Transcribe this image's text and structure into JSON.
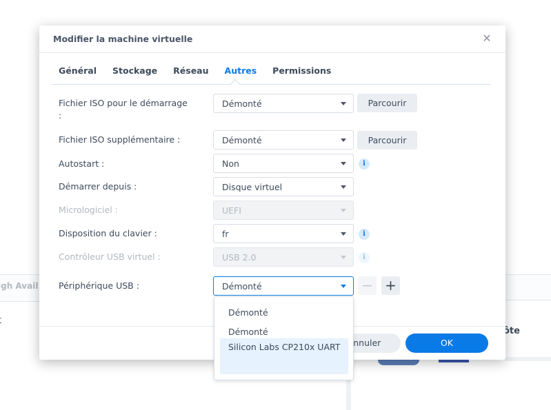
{
  "background": {
    "left_panel_title": "igh Avail",
    "left_text": "t",
    "right_text": "ôte"
  },
  "dialog": {
    "title": "Modifier la machine virtuelle",
    "close_icon": "close-icon",
    "tabs": [
      {
        "label": "Général",
        "active": false
      },
      {
        "label": "Stockage",
        "active": false
      },
      {
        "label": "Réseau",
        "active": false
      },
      {
        "label": "Autres",
        "active": true
      },
      {
        "label": "Permissions",
        "active": false
      }
    ],
    "accent_color": "#0a7ae6",
    "fields": {
      "boot_iso": {
        "label": "Fichier ISO pour le démarrage",
        "label_suffix": ":",
        "value": "Démonté",
        "button": "Parcourir"
      },
      "extra_iso": {
        "label": "Fichier ISO supplémentaire :",
        "value": "Démonté",
        "button": "Parcourir"
      },
      "autostart": {
        "label": "Autostart :",
        "value": "Non",
        "info_icon": "info-icon"
      },
      "boot_from": {
        "label": "Démarrer depuis :",
        "value": "Disque virtuel"
      },
      "firmware": {
        "label": "Micrologiciel :",
        "value": "UEFI",
        "disabled": true
      },
      "keyboard": {
        "label": "Disposition du clavier :",
        "value": "fr",
        "info_icon": "info-icon"
      },
      "usb_controller": {
        "label": "Contrôleur USB virtuel :",
        "value": "USB 2.0",
        "disabled": true,
        "info_icon": "info-icon"
      },
      "usb_device": {
        "label": "Périphérique USB :",
        "value": "Démonté",
        "open": true,
        "remove_icon": "minus-icon",
        "add_icon": "plus-icon"
      }
    },
    "usb_dropdown_options": [
      "Démonté",
      "Démonté",
      "Silicon Labs CP210x UART"
    ],
    "usb_dropdown_hovered_index": 2,
    "footer": {
      "cancel_label": "Annuler",
      "ok_label": "OK"
    }
  }
}
